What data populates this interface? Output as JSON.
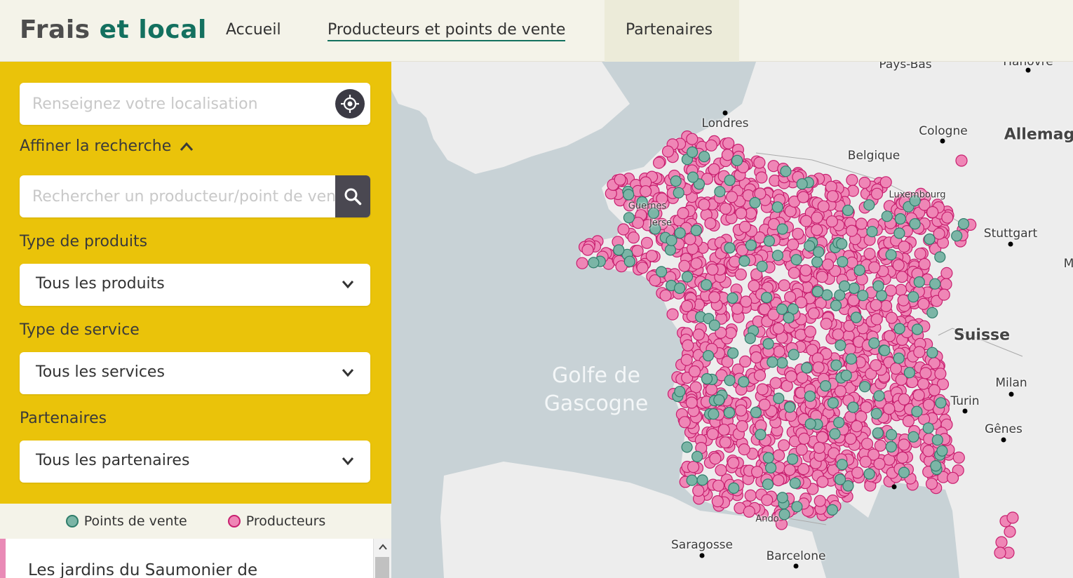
{
  "header": {
    "logo_part1": "Frais",
    "logo_part2": "et local",
    "nav": [
      {
        "label": "Accueil"
      },
      {
        "label": "Producteurs et points de vente"
      },
      {
        "label": "Partenaires"
      }
    ]
  },
  "sidebar": {
    "location_placeholder": "Renseignez votre localisation",
    "refine_label": "Affiner la recherche",
    "search_placeholder": "Rechercher un producteur/point de vente",
    "filters": [
      {
        "label": "Type de produits",
        "value": "Tous les produits"
      },
      {
        "label": "Type de service",
        "value": "Tous les services"
      },
      {
        "label": "Partenaires",
        "value": "Tous les partenaires"
      }
    ]
  },
  "legend": {
    "points_de_vente": "Points de vente",
    "producteurs": "Producteurs"
  },
  "results": {
    "first_title": "Les jardins du Saumonier de"
  },
  "map": {
    "sea_label_1": "Golfe de",
    "sea_label_2": "Gascogne",
    "cities": {
      "londres": "Londres",
      "pays_bas": "Pays-Bas",
      "belgique": "Belgique",
      "cologne": "Cologne",
      "allemagne": "Allemag",
      "luxembourg": "Luxembourg",
      "stuttgart": "Stuttgart",
      "suisse": "Suisse",
      "milan": "Milan",
      "turin": "Turin",
      "genes": "Gênes",
      "saragosse": "Saragosse",
      "barcelone": "Barcelone",
      "guernesey": "Guernes",
      "jersey": "Jerse",
      "andorre": "Ando",
      "hanovre": "Hanovre",
      "munich_m": "M"
    }
  },
  "colors": {
    "brand_green": "#13705f",
    "sidebar_yellow": "#eac30a",
    "producer_pink": "#ef86b6",
    "producer_border": "#c81f6f",
    "store_green": "#7bb5a6"
  }
}
